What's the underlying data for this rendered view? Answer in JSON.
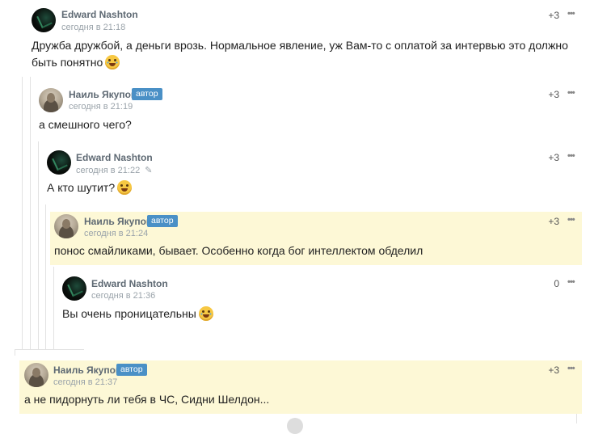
{
  "comments": [
    {
      "author": "Edward Nashton",
      "time": "сегодня в 21:18",
      "score": "+3",
      "more": "•••",
      "text": "Дружба дружбой, а деньги врозь. Нормальное явление, уж Вам-то с оплатой за интервью это должно быть понятно",
      "emoji": "tears-of-joy-emoji-icon"
    },
    {
      "author": "Наиль Якупов",
      "badge": "автор",
      "time": "сегодня в 21:19",
      "score": "+3",
      "more": "•••",
      "text": "а смешного чего?"
    },
    {
      "author": "Edward Nashton",
      "time": "сегодня в 21:22",
      "score": "+3",
      "more": "•••",
      "text": "А кто шутит?",
      "emoji": "smile-emoji-icon",
      "edited_icon": "pencil-icon"
    },
    {
      "author": "Наиль Якупов",
      "badge": "автор",
      "time": "сегодня в 21:24",
      "score": "+3",
      "more": "•••",
      "text": "понос смайликами, бывает. Особенно когда бог интеллектом обделил"
    },
    {
      "author": "Edward Nashton",
      "time": "сегодня в 21:36",
      "score": "0",
      "more": "•••",
      "text": "Вы очень проницательны",
      "emoji": "tears-of-joy-emoji-icon"
    },
    {
      "author": "Наиль Якупов",
      "badge": "автор",
      "time": "сегодня в 21:37",
      "score": "+3",
      "more": "•••",
      "text": "а не пидорнуть ли тебя в ЧС, Сидни Шелдон..."
    }
  ],
  "colors": {
    "highlight": "#fdf8d6",
    "badge": "#4a90c6",
    "thread_line": "#e2e2e2"
  }
}
